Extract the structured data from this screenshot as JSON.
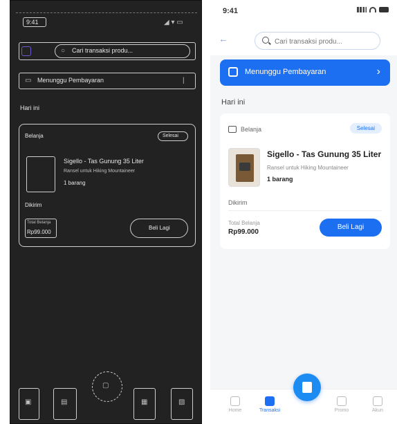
{
  "status_bar": {
    "time": "9:41"
  },
  "search": {
    "placeholder": "Cari transaksi produ..."
  },
  "banner": {
    "label": "Menunggu Pembayaran"
  },
  "section": {
    "label": "Hari ini"
  },
  "order": {
    "category": "Belanja",
    "badge": "Selesai",
    "product_name": "Sigello - Tas Gunung 35 Liter",
    "product_desc": "Ransel untuk Hiking Mountaineer",
    "quantity": "1 barang",
    "status": "Dikirim",
    "total_label": "Total Belanja",
    "total_value": "Rp99.000",
    "buy_again": "Beli Lagi"
  },
  "nav": {
    "items": [
      "Home",
      "Transaksi",
      "",
      "Promo",
      "Akun"
    ]
  },
  "colors": {
    "primary": "#1d6ff2",
    "background": "#f5f6f8"
  }
}
